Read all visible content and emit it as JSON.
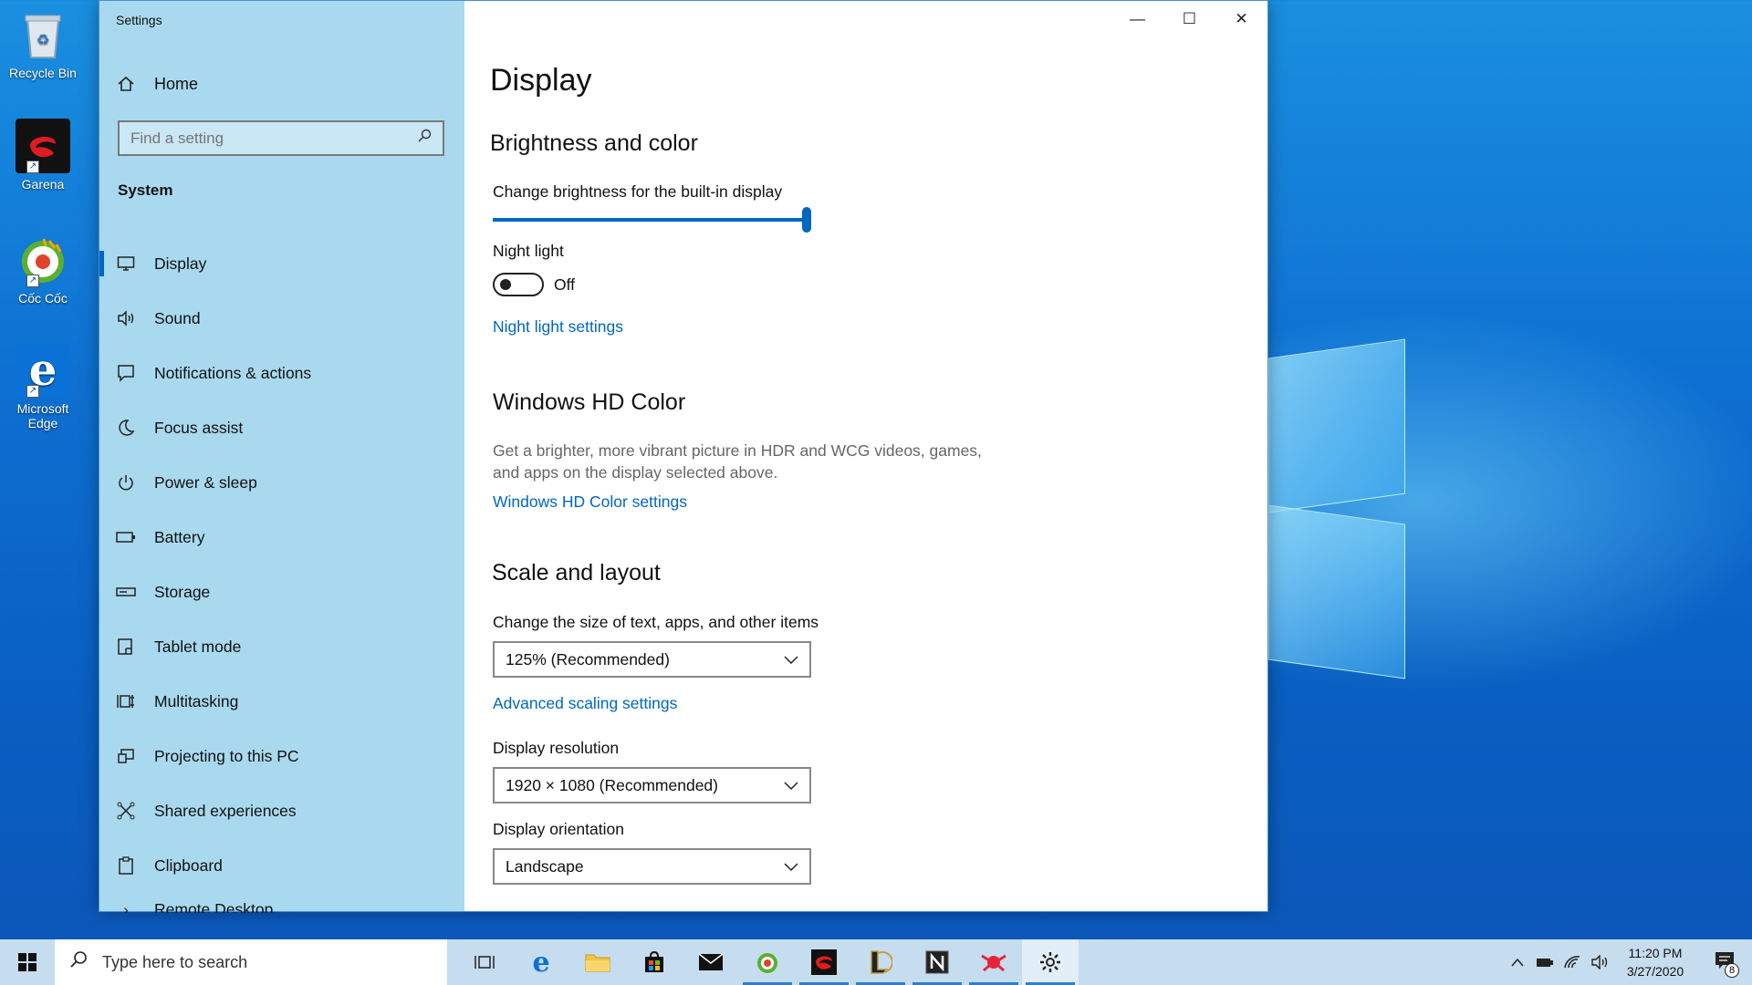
{
  "desktop": {
    "icons": [
      {
        "label": "Recycle Bin",
        "icon": "recycle-bin-icon"
      },
      {
        "label": "Garena",
        "icon": "garena-icon"
      },
      {
        "label": "Cốc Cốc",
        "icon": "coccoc-icon"
      },
      {
        "label": "Microsoft Edge",
        "icon": "edge-icon"
      }
    ]
  },
  "window": {
    "title": "Settings",
    "buttons": {
      "minimize": "—",
      "maximize": "☐",
      "close": "✕"
    }
  },
  "sidebar": {
    "home_label": "Home",
    "search_placeholder": "Find a setting",
    "section": "System",
    "items": [
      {
        "label": "Display",
        "icon": "monitor-icon",
        "active": true
      },
      {
        "label": "Sound",
        "icon": "speaker-icon"
      },
      {
        "label": "Notifications & actions",
        "icon": "notification-icon"
      },
      {
        "label": "Focus assist",
        "icon": "moon-icon"
      },
      {
        "label": "Power & sleep",
        "icon": "power-icon"
      },
      {
        "label": "Battery",
        "icon": "battery-icon"
      },
      {
        "label": "Storage",
        "icon": "storage-icon"
      },
      {
        "label": "Tablet mode",
        "icon": "tablet-icon"
      },
      {
        "label": "Multitasking",
        "icon": "multitasking-icon"
      },
      {
        "label": "Projecting to this PC",
        "icon": "projecting-icon"
      },
      {
        "label": "Shared experiences",
        "icon": "shared-icon"
      },
      {
        "label": "Clipboard",
        "icon": "clipboard-icon"
      },
      {
        "label": "Remote Desktop",
        "icon": "remote-desktop-icon"
      }
    ]
  },
  "content": {
    "page_title": "Display",
    "brightness": {
      "heading": "Brightness and color",
      "slider_label": "Change brightness for the built-in display",
      "level": 1.0,
      "night_light_label": "Night light",
      "night_light_state": "Off",
      "night_light_link": "Night light settings"
    },
    "hdr": {
      "heading": "Windows HD Color",
      "description": "Get a brighter, more vibrant picture in HDR and WCG videos, games, and apps on the display selected above.",
      "link": "Windows HD Color settings"
    },
    "scale": {
      "heading": "Scale and layout",
      "size_label": "Change the size of text, apps, and other items",
      "size_value": "125% (Recommended)",
      "advanced_link": "Advanced scaling settings",
      "resolution_label": "Display resolution",
      "resolution_value": "1920 × 1080 (Recommended)",
      "orientation_label": "Display orientation",
      "orientation_value": "Landscape"
    }
  },
  "taskbar": {
    "search_placeholder": "Type here to search",
    "apps": [
      "task-view-icon",
      "edge-icon",
      "file-explorer-icon",
      "store-icon",
      "mail-icon",
      "coccoc-icon",
      "garena-icon",
      "league-icon",
      "notion-icon",
      "app-red-icon",
      "settings-gear-icon"
    ],
    "time": "11:20 PM",
    "date": "3/27/2020",
    "notification_count": "8"
  },
  "colors": {
    "accent": "#0067c0",
    "sidebar": "#a9d9ef",
    "taskbar": "#c6dcef"
  }
}
